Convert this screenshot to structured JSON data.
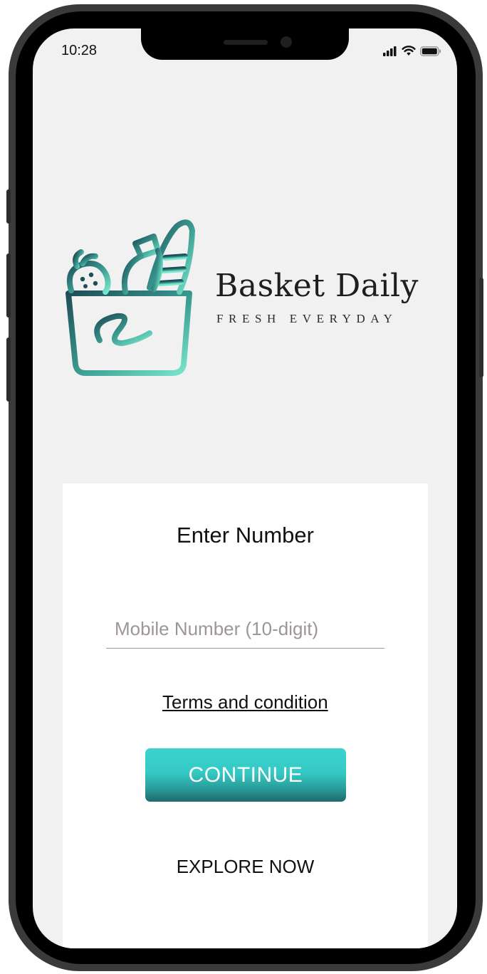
{
  "status_bar": {
    "time": "10:28",
    "icons": [
      "cellular-signal-icon",
      "wifi-icon",
      "battery-icon"
    ]
  },
  "brand": {
    "name": "Basket Daily",
    "tagline": "FRESH EVERYDAY",
    "logo_icon": "grocery-basket-icon",
    "gradient_colors": [
      "#1e4d57",
      "#7ae8cc"
    ]
  },
  "login": {
    "title": "Enter Number",
    "mobile_placeholder": "Mobile Number (10-digit)",
    "terms_label": "Terms and condition",
    "continue_label": "CONTINUE",
    "explore_label": "EXPLORE NOW"
  },
  "colors": {
    "background": "#f1f1f1",
    "accent": "#3ad3cf",
    "accent_dark": "#1f6a6e",
    "card": "#ffffff"
  }
}
